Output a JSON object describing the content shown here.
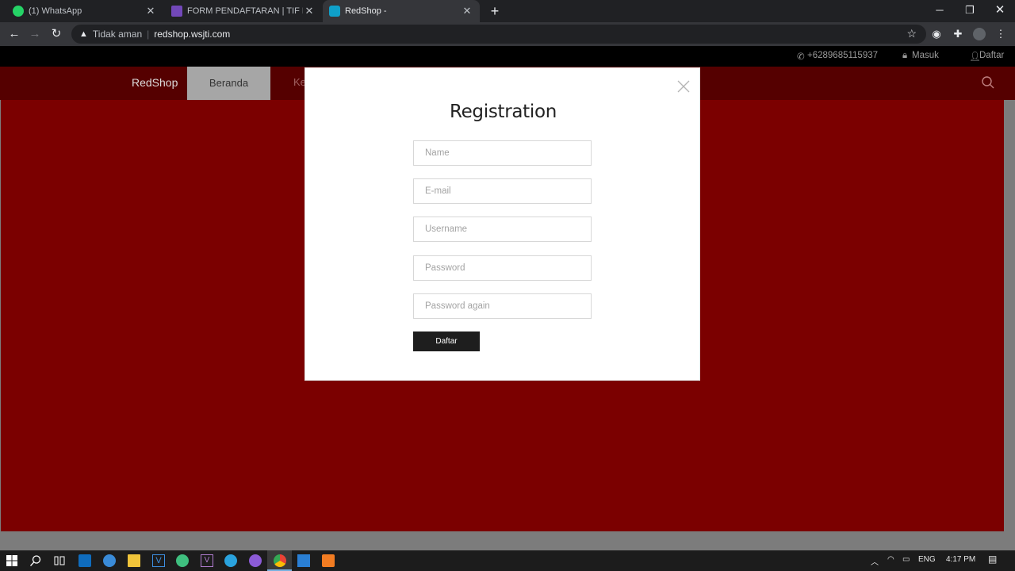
{
  "browser": {
    "tabs": [
      {
        "title": "(1) WhatsApp",
        "favicon": "whatsapp-icon",
        "color": "#25d366"
      },
      {
        "title": "FORM PENDAFTARAN | TIF EXHIB",
        "favicon": "google-forms-icon",
        "color": "#7248b9"
      },
      {
        "title": "RedShop -",
        "favicon": "redshop-icon",
        "color": "#0fa0c9",
        "active": true
      }
    ],
    "security_label": "Tidak aman",
    "url": "redshop.wsjti.com"
  },
  "page": {
    "topbar": {
      "phone": "+6289685115937",
      "login": "Masuk",
      "register": "Daftar"
    },
    "nav": {
      "brand": "RedShop",
      "items": [
        "Beranda",
        "Ke"
      ]
    },
    "modal": {
      "title": "Registration",
      "fields": [
        {
          "placeholder": "Name"
        },
        {
          "placeholder": "E-mail"
        },
        {
          "placeholder": "Username"
        },
        {
          "placeholder": "Password"
        },
        {
          "placeholder": "Password again"
        }
      ],
      "submit_label": "Daftar"
    },
    "colors": {
      "navbar": "#550000",
      "background": "#7b0000",
      "active_nav": "#a6a6a6",
      "button": "#1e1e1e"
    }
  },
  "taskbar": {
    "language": "ENG",
    "time": "4:17 PM"
  }
}
